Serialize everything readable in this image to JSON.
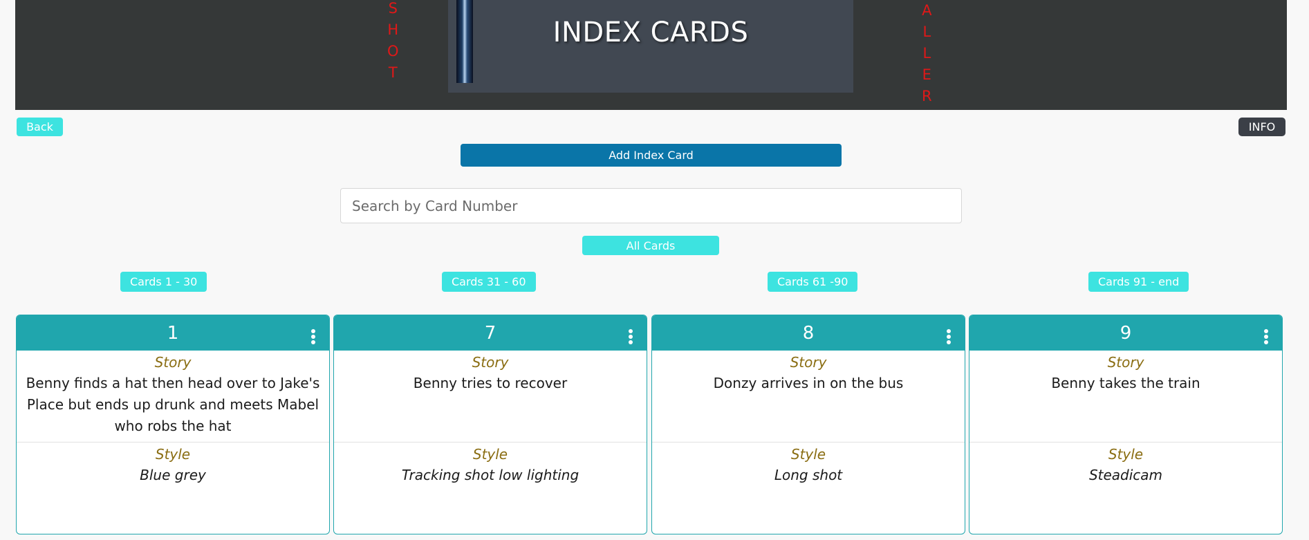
{
  "header": {
    "title": "INDEX CARDS",
    "left_vertical": [
      "S",
      "H",
      "O",
      "T"
    ],
    "right_vertical": [
      "A",
      "L",
      "L",
      "E",
      "R"
    ]
  },
  "nav": {
    "back_label": "Back",
    "info_label": "INFO"
  },
  "actions": {
    "add_card_label": "Add Index Card",
    "all_cards_label": "All Cards"
  },
  "search": {
    "placeholder": "Search by Card Number",
    "value": ""
  },
  "ranges": [
    "Cards 1 - 30",
    "Cards 31 - 60",
    "Cards 61 -90",
    "Cards 91 - end"
  ],
  "cards": [
    {
      "number": "1",
      "story_label": "Story",
      "story": "Benny finds a hat then head over to Jake's Place but ends up drunk and meets Mabel who robs the hat",
      "style_label": "Style",
      "style": "Blue grey"
    },
    {
      "number": "7",
      "story_label": "Story",
      "story": "Benny tries to recover",
      "style_label": "Style",
      "style": "Tracking shot low lighting"
    },
    {
      "number": "8",
      "story_label": "Story",
      "story": "Donzy arrives in on the bus",
      "style_label": "Style",
      "style": "Long shot"
    },
    {
      "number": "9",
      "story_label": "Story",
      "story": "Benny takes the train",
      "style_label": "Style",
      "style": "Steadicam"
    }
  ],
  "colors": {
    "header_bg": "#353838",
    "banner_bg": "#414852",
    "accent_cyan": "#3de3e0",
    "card_teal": "#20a6ad",
    "primary_blue": "#0a75a8",
    "vertical_text_red": "#e01818",
    "label_gold": "#8a6d12"
  }
}
